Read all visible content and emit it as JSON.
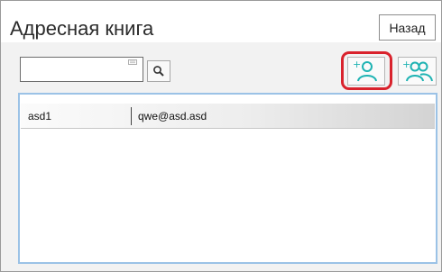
{
  "header": {
    "title": "Адресная книга",
    "back_label": "Назад"
  },
  "search": {
    "value": "",
    "search_icon": "magnifier-icon",
    "keyboard_icon": "keyboard-icon"
  },
  "toolbar": {
    "add_contact_icon": "add-person-icon",
    "add_group_icon": "add-group-icon",
    "highlight_color": "#d9232d",
    "icon_color": "#1fb3b3"
  },
  "contacts": {
    "columns": [
      "name",
      "email"
    ],
    "rows": [
      {
        "name": "asd1",
        "email": "qwe@asd.asd"
      }
    ]
  }
}
